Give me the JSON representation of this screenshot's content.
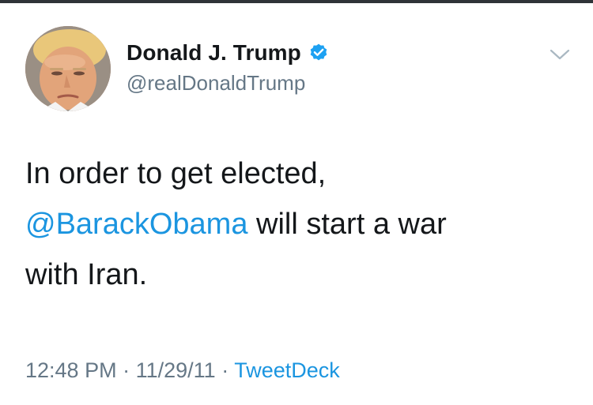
{
  "tweet": {
    "author": {
      "display_name": "Donald J. Trump",
      "handle": "@realDonaldTrump",
      "verified": true,
      "verified_icon": "verified-badge-icon"
    },
    "text_line1": "In order to get elected,",
    "mention": "@BarackObama",
    "text_after_mention": " will start a war",
    "text_line3": "with Iran.",
    "time": "12:48 PM",
    "separator": "·",
    "date": "11/29/11",
    "source": "TweetDeck",
    "menu_icon": "chevron-down-icon"
  },
  "colors": {
    "text": "#14171a",
    "secondary": "#657786",
    "link": "#1b95e0",
    "verified": "#1da1f2",
    "top_border": "#2f3338"
  }
}
